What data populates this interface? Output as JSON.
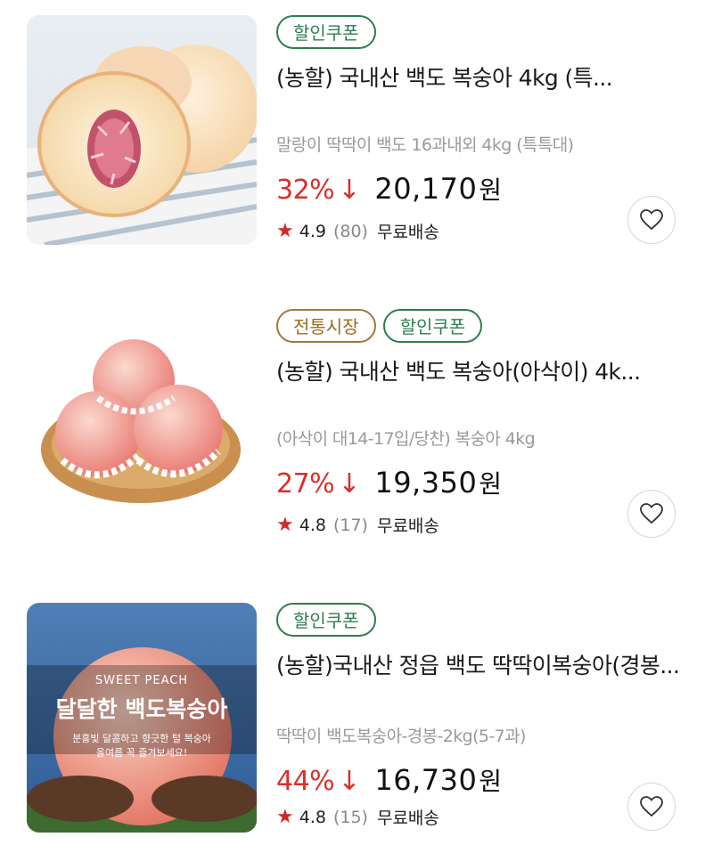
{
  "products": [
    {
      "tags": [
        "할인쿠폰"
      ],
      "title": "(농할) 국내산 백도 복숭아 4kg (특...",
      "subtitle": "말랑이 딱딱이 백도 16과내외 4kg (특특대)",
      "discount": "32%",
      "arrow": "↓",
      "price": "20,170",
      "currency": "원",
      "rating": "4.9",
      "review_count": "(80)",
      "shipping": "무료배송",
      "image_icon": "peach-cut-icon"
    },
    {
      "tags": [
        "전통시장",
        "할인쿠폰"
      ],
      "title": "(농할) 국내산 백도 복숭아(아삭이) 4k...",
      "subtitle": "(아삭이 대14-17입/당찬) 복숭아 4kg",
      "discount": "27%",
      "arrow": "↓",
      "price": "19,350",
      "currency": "원",
      "rating": "4.8",
      "review_count": "(17)",
      "shipping": "무료배송",
      "image_icon": "peach-basket-icon"
    },
    {
      "tags": [
        "할인쿠폰"
      ],
      "title": "(농할)국내산 정읍 백도 딱딱이복숭아(경봉...",
      "subtitle": "딱딱이 백도복숭아-경봉-2kg(5-7과)",
      "discount": "44%",
      "arrow": "↓",
      "price": "16,730",
      "currency": "원",
      "rating": "4.8",
      "review_count": "(15)",
      "shipping": "무료배송",
      "image_icon": "peach-hands-icon",
      "banner": {
        "eyebrow": "SWEET PEACH",
        "headline": "달달한 백도복숭아",
        "line1": "분홍빛 달콤하고 향긋한 털 복숭아",
        "line2": "올여름 꼭 즐겨보세요!"
      }
    }
  ],
  "colors": {
    "coupon_tag": "#2e7d4f",
    "market_tag": "#9b6a22",
    "discount": "#d9302a",
    "star": "#d02a2a"
  }
}
